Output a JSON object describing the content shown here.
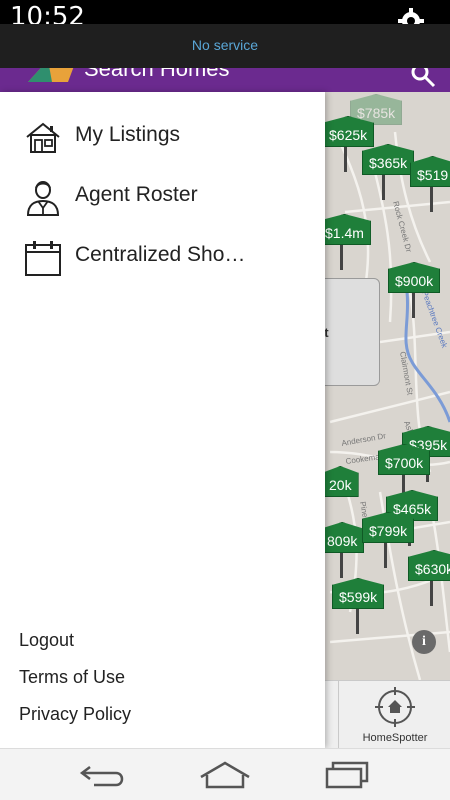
{
  "status_bar": {
    "time": "10:52",
    "settings_icon": "gear-icon"
  },
  "toast": {
    "text": "No service"
  },
  "app_bar": {
    "title": "Search Homes",
    "search_icon": "search-icon",
    "color": "#6b2a8f"
  },
  "map": {
    "pins": [
      "$785k",
      "$625k",
      "$365k",
      "$519",
      "$1.4m",
      "$900k",
      "$395k",
      "$700k",
      "20k",
      "$465k",
      "809k",
      "$799k",
      "$630k",
      "$599k"
    ],
    "card_text": "et",
    "info_label": "i",
    "street_labels": [
      "Anderson Dr",
      "Cookeman Dr",
      "Pineland Dr",
      "Clairmont St",
      "Ashley Dr",
      "Rock Creek Dr",
      "Peachtree Creek"
    ]
  },
  "tabbar": {
    "homespotter_label": "HomeSpotter"
  },
  "drawer": {
    "items": [
      {
        "label": "My Listings",
        "icon": "house-icon"
      },
      {
        "label": "Agent Roster",
        "icon": "agent-icon"
      },
      {
        "label": "Centralized Sho…",
        "icon": "calendar-icon"
      }
    ],
    "footer": {
      "logout": "Logout",
      "terms": "Terms of Use",
      "privacy": "Privacy Policy"
    }
  },
  "navbar": {
    "back_icon": "back-icon",
    "home_icon": "home-icon",
    "recents_icon": "recents-icon"
  },
  "colors": {
    "pin_green": "#1f7f3a",
    "accent_blue": "#5aa6d6"
  }
}
